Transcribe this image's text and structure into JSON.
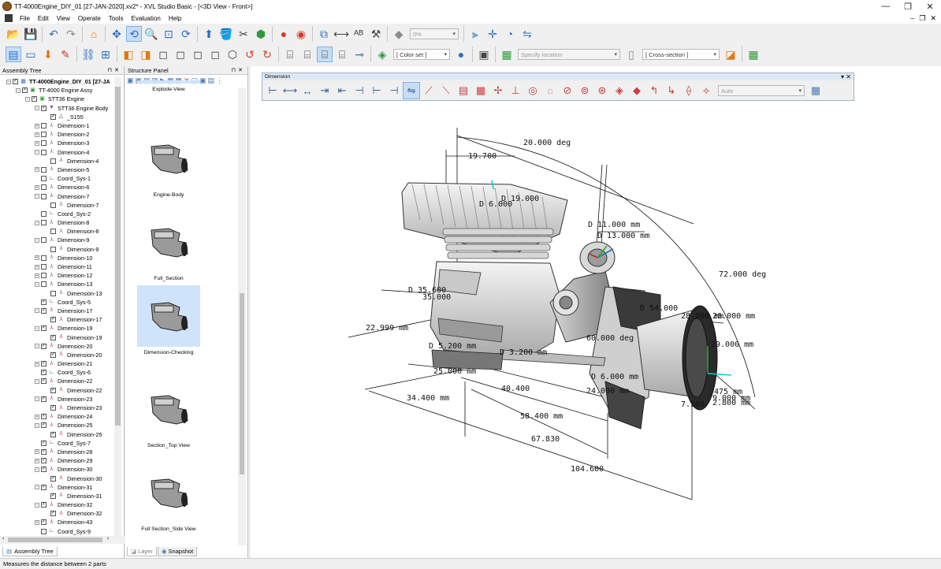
{
  "window": {
    "title": "TT-4000Engine_DIY_01 [27-JAN-2020].xv2* - XVL Studio Basic - [<3D View - Front>]"
  },
  "menu": {
    "items": [
      "File",
      "Edit",
      "View",
      "Operate",
      "Tools",
      "Evaluation",
      "Help"
    ]
  },
  "toolbar": {
    "opacity_value": "0%",
    "color_set": "[ Color set ]",
    "location_placeholder": "Specify location",
    "cross_section": "[ Cross-section ]"
  },
  "assembly_tree": {
    "title": "Assembly Tree",
    "nodes": [
      {
        "label": "TT-4000Engine_DIY_01 [27-JA",
        "depth": 0,
        "exp": "-",
        "chk": "✓",
        "icon": "asm-root",
        "bold": true
      },
      {
        "label": "TT-4000 Engine Assy",
        "depth": 1,
        "exp": "-",
        "chk": "✓",
        "icon": "asm"
      },
      {
        "label": "STT36 Engine",
        "depth": 2,
        "exp": "-",
        "chk": "✓",
        "icon": "asm"
      },
      {
        "label": "STT36 Engine Body",
        "depth": 3,
        "exp": "-",
        "chk": "✓",
        "icon": "part"
      },
      {
        "label": "_S155",
        "depth": 4,
        "exp": "",
        "chk": "✓",
        "icon": "triangle"
      },
      {
        "label": "Dimension-1",
        "depth": 3,
        "exp": "+",
        "chk": "",
        "icon": "dim"
      },
      {
        "label": "Dimension-2",
        "depth": 3,
        "exp": "+",
        "chk": "",
        "icon": "dim"
      },
      {
        "label": "Dimension-3",
        "depth": 3,
        "exp": "+",
        "chk": "",
        "icon": "dim"
      },
      {
        "label": "Dimension-4",
        "depth": 3,
        "exp": "-",
        "chk": "",
        "icon": "dim"
      },
      {
        "label": "Dimension-4",
        "depth": 4,
        "exp": "",
        "chk": "",
        "icon": "dim"
      },
      {
        "label": "Dimension-5",
        "depth": 3,
        "exp": "+",
        "chk": "",
        "icon": "dim"
      },
      {
        "label": "Coord_Sys-1",
        "depth": 3,
        "exp": "",
        "chk": "",
        "icon": "coord"
      },
      {
        "label": "Dimension-6",
        "depth": 3,
        "exp": "+",
        "chk": "",
        "icon": "dim"
      },
      {
        "label": "Dimension-7",
        "depth": 3,
        "exp": "-",
        "chk": "",
        "icon": "dim"
      },
      {
        "label": "Dimension-7",
        "depth": 4,
        "exp": "",
        "chk": "",
        "icon": "dim"
      },
      {
        "label": "Coord_Sys-2",
        "depth": 3,
        "exp": "",
        "chk": "",
        "icon": "coord"
      },
      {
        "label": "Dimension-8",
        "depth": 3,
        "exp": "-",
        "chk": "",
        "icon": "dim"
      },
      {
        "label": "Dimension-8",
        "depth": 4,
        "exp": "",
        "chk": "",
        "icon": "dim"
      },
      {
        "label": "Dimension-9",
        "depth": 3,
        "exp": "-",
        "chk": "",
        "icon": "dim"
      },
      {
        "label": "Dimension-9",
        "depth": 4,
        "exp": "",
        "chk": "",
        "icon": "dim"
      },
      {
        "label": "Dimension-10",
        "depth": 3,
        "exp": "+",
        "chk": "",
        "icon": "dim"
      },
      {
        "label": "Dimension-11",
        "depth": 3,
        "exp": "+",
        "chk": "",
        "icon": "dim"
      },
      {
        "label": "Dimension-12",
        "depth": 3,
        "exp": "+",
        "chk": "",
        "icon": "dim"
      },
      {
        "label": "Dimension-13",
        "depth": 3,
        "exp": "-",
        "chk": "",
        "icon": "dim"
      },
      {
        "label": "Dimension-13",
        "depth": 4,
        "exp": "",
        "chk": "",
        "icon": "dim"
      },
      {
        "label": "Coord_Sys-5",
        "depth": 3,
        "exp": "",
        "chk": "✓",
        "icon": "coord"
      },
      {
        "label": "Dimension-17",
        "depth": 3,
        "exp": "-",
        "chk": "✓",
        "icon": "dim-r"
      },
      {
        "label": "Dimension-17",
        "depth": 4,
        "exp": "",
        "chk": "✓",
        "icon": "dim-r"
      },
      {
        "label": "Dimension-19",
        "depth": 3,
        "exp": "-",
        "chk": "✓",
        "icon": "dim-r"
      },
      {
        "label": "Dimension-19",
        "depth": 4,
        "exp": "",
        "chk": "✓",
        "icon": "dim-r"
      },
      {
        "label": "Dimension-20",
        "depth": 3,
        "exp": "-",
        "chk": "✓",
        "icon": "dim-r"
      },
      {
        "label": "Dimension-20",
        "depth": 4,
        "exp": "",
        "chk": "✓",
        "icon": "dim-r"
      },
      {
        "label": "Dimension-21",
        "depth": 3,
        "exp": "+",
        "chk": "✓",
        "icon": "dim-r"
      },
      {
        "label": "Coord_Sys-6",
        "depth": 3,
        "exp": "",
        "chk": "✓",
        "icon": "coord"
      },
      {
        "label": "Dimension-22",
        "depth": 3,
        "exp": "-",
        "chk": "✓",
        "icon": "dim-r"
      },
      {
        "label": "Dimension-22",
        "depth": 4,
        "exp": "",
        "chk": "✓",
        "icon": "dim-r"
      },
      {
        "label": "Dimension-23",
        "depth": 3,
        "exp": "-",
        "chk": "✓",
        "icon": "dim-r"
      },
      {
        "label": "Dimension-23",
        "depth": 4,
        "exp": "",
        "chk": "✓",
        "icon": "dim-r"
      },
      {
        "label": "Dimension-24",
        "depth": 3,
        "exp": "+",
        "chk": "✓",
        "icon": "dim-r"
      },
      {
        "label": "Dimension-25",
        "depth": 3,
        "exp": "-",
        "chk": "✓",
        "icon": "dim-r"
      },
      {
        "label": "Dimension-25",
        "depth": 4,
        "exp": "",
        "chk": "✓",
        "icon": "dim-r"
      },
      {
        "label": "Coord_Sys-7",
        "depth": 3,
        "exp": "",
        "chk": "✓",
        "icon": "coord"
      },
      {
        "label": "Dimension-28",
        "depth": 3,
        "exp": "+",
        "chk": "✓",
        "icon": "dim-r"
      },
      {
        "label": "Dimension-29",
        "depth": 3,
        "exp": "+",
        "chk": "✓",
        "icon": "dim-r"
      },
      {
        "label": "Dimension-30",
        "depth": 3,
        "exp": "-",
        "chk": "✓",
        "icon": "dim-r"
      },
      {
        "label": "Dimension-30",
        "depth": 4,
        "exp": "",
        "chk": "✓",
        "icon": "dim-r"
      },
      {
        "label": "Dimension-31",
        "depth": 3,
        "exp": "-",
        "chk": "✓",
        "icon": "dim-r"
      },
      {
        "label": "Dimension-31",
        "depth": 4,
        "exp": "",
        "chk": "✓",
        "icon": "dim-r"
      },
      {
        "label": "Dimension-32",
        "depth": 3,
        "exp": "-",
        "chk": "✓",
        "icon": "dim-r"
      },
      {
        "label": "Dimension-32",
        "depth": 4,
        "exp": "",
        "chk": "✓",
        "icon": "dim-r"
      },
      {
        "label": "Dimension-43",
        "depth": 3,
        "exp": "+",
        "chk": "✓",
        "icon": "dim-r"
      },
      {
        "label": "Coord_Sys-9",
        "depth": 3,
        "exp": "",
        "chk": "",
        "icon": "coord"
      }
    ],
    "tab_label": "Assembly Tree"
  },
  "structure_panel": {
    "title": "Structure Panel",
    "snapshots": [
      "Explode-View",
      "Engine-Body",
      "Full_Section",
      "Dimension-Checking",
      "Section_Top View",
      "Full Section_Side View"
    ],
    "selected": "Dimension-Checking",
    "tabs": [
      "Layer",
      "Snapshot"
    ]
  },
  "dimension_toolbar": {
    "title": "Dimension",
    "auto_value": "Auto"
  },
  "annotations": [
    "20.000 deg",
    "19.700",
    "D 19.000",
    "D 6.000",
    "D 11.000 mm",
    "D 13.000 mm",
    "72.000 deg",
    "D 35.600",
    "35.000",
    "22.999 mm",
    "D 54.000",
    "28.000 mm",
    "26.000 mm",
    "60.000 deg",
    "29.000 mm",
    "D 3.200 mm",
    "D 5.200 mm",
    "25.000 mm",
    "D 6.000 mm",
    "24.000 mm",
    "40.400",
    "34.400 mm",
    "58.400 mm",
    "475 mm",
    "9.000 mm",
    "7.500",
    "2.800 mm",
    "67.830",
    "104.600"
  ],
  "status": {
    "text": "Measures the distance between 2 parts"
  }
}
